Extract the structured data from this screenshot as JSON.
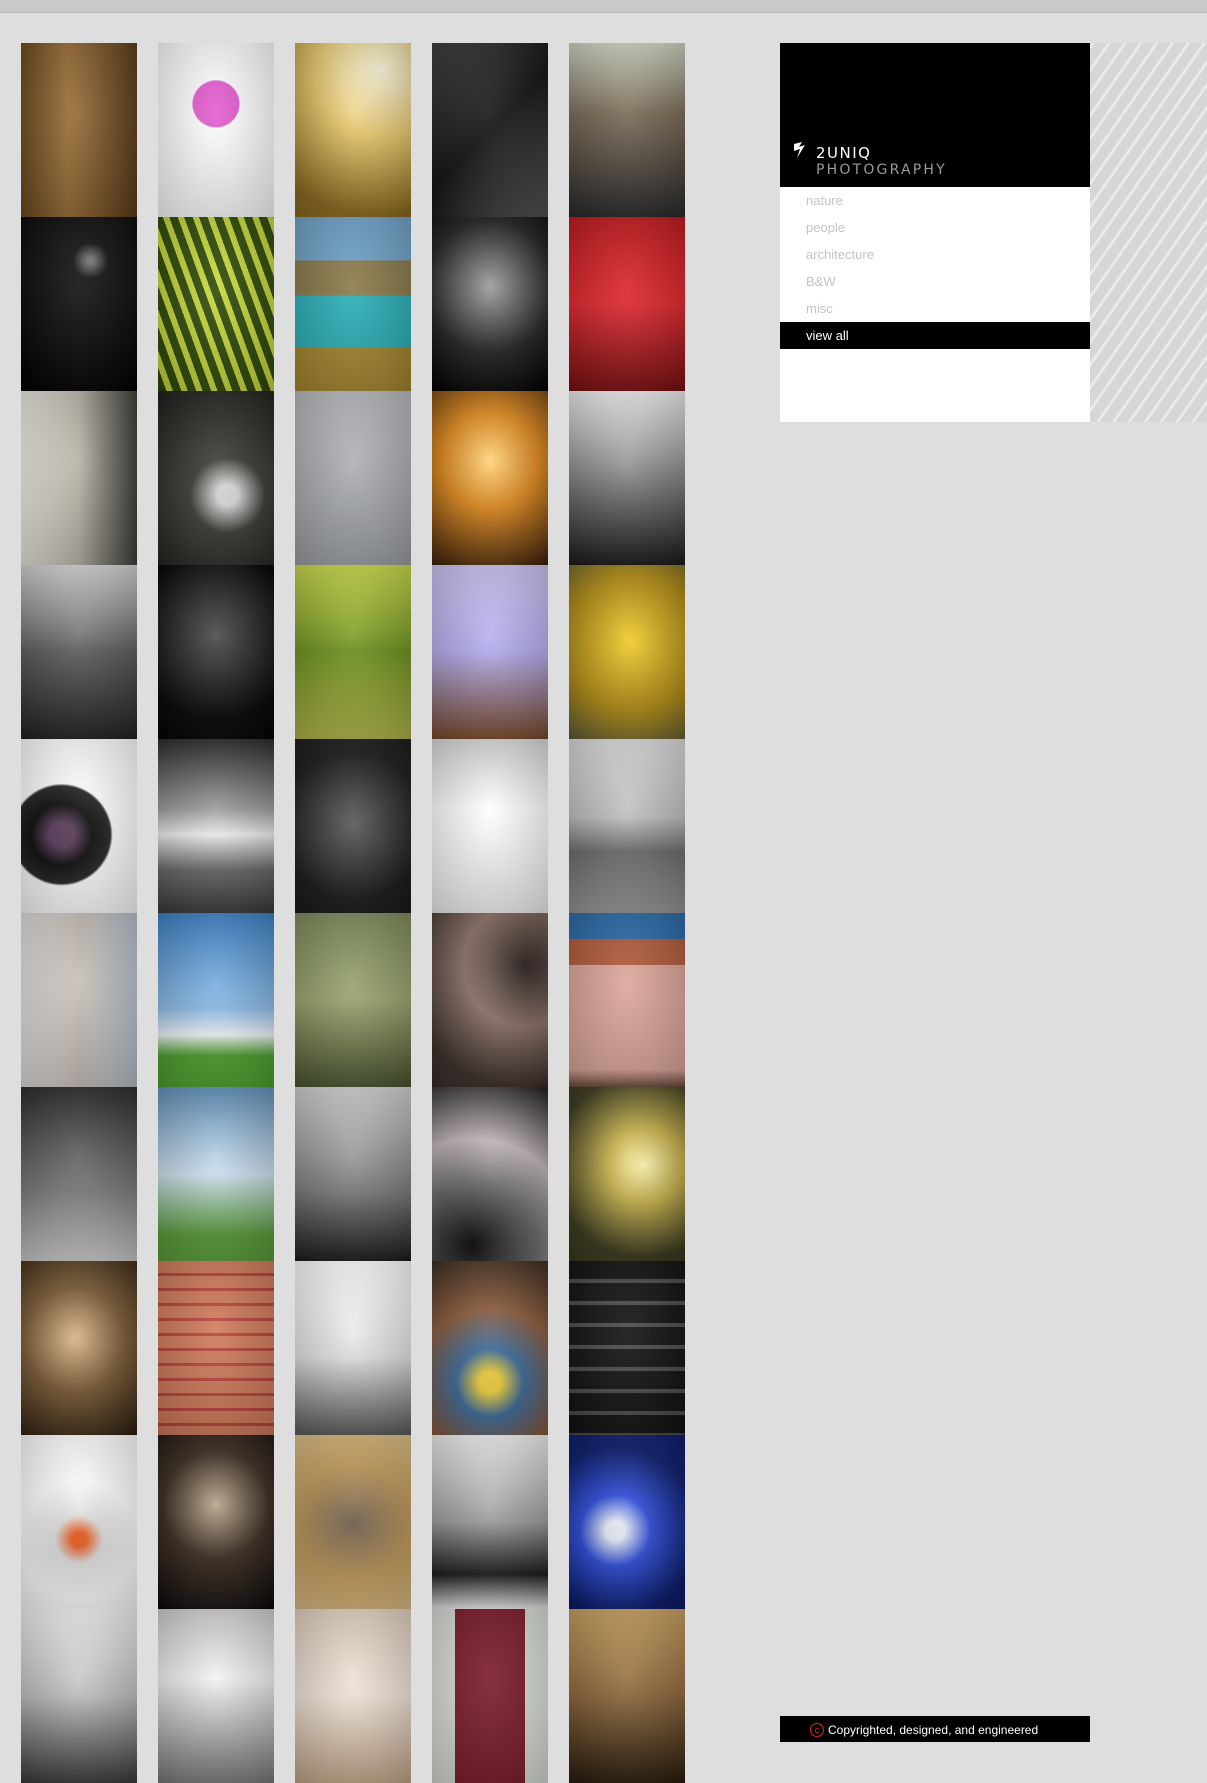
{
  "brand": {
    "line1": "2UNIQ",
    "line2": "PHOTOGRAPHY"
  },
  "nav": [
    {
      "label": "nature",
      "active": false
    },
    {
      "label": "people",
      "active": false
    },
    {
      "label": "architecture",
      "active": false
    },
    {
      "label": "B&W",
      "active": false
    },
    {
      "label": "misc",
      "active": false
    },
    {
      "label": "view all",
      "active": true
    }
  ],
  "footer": {
    "text": "Copyrighted, designed, and engineered"
  },
  "colors": {
    "background": "#dedede",
    "panel": "#ffffff",
    "logo_bg": "#000000",
    "nav_inactive": "#c3c3c3",
    "nav_active_bg": "#000000",
    "copyright_icon": "#e0242a"
  },
  "photos": [
    {
      "subject": "leaf-on-wood",
      "fill": "linear-gradient(90deg,#6b4a20,#9a6e35 40%,#7a5428 70%,#5a3c18)"
    },
    {
      "subject": "pink-orchid",
      "fill": "radial-gradient(circle at 50% 35%,#e35ccf 0 18%,#ffffff 19%)"
    },
    {
      "subject": "power-tower-sunset",
      "fill": "radial-gradient(circle at 75% 15%,#fffbe0,#e8c76a 40%,#8b6a1e 85%)"
    },
    {
      "subject": "horse-bw",
      "fill": "linear-gradient(135deg,#3c3c3c,#111 50%,#555)"
    },
    {
      "subject": "man-portrait",
      "fill": "linear-gradient(180deg,#cfd7c4,#7a6a55 40%,#2a2a2a)"
    },
    {
      "subject": "night-street",
      "fill": "radial-gradient(circle at 60% 25%,#777 0 2%,#111 12%,#000)"
    },
    {
      "subject": "green-leaf",
      "fill": "repeating-linear-gradient(70deg,#2f4a08 0 8px,#c9d83a 8px 14px)"
    },
    {
      "subject": "river-canyon",
      "fill": "linear-gradient(180deg,#6fa3c8 0 25%,#8a7a4a 25% 45%,#2ab0b8 45% 75%,#a6882f 75%)"
    },
    {
      "subject": "cap-portrait-bw",
      "fill": "radial-gradient(circle at 50% 40%,#9c9c9c,#222 55%,#000)"
    },
    {
      "subject": "red-box-latch",
      "fill": "linear-gradient(180deg,#c0181c,#e0262c 50%,#7a0f12)"
    },
    {
      "subject": "arm-window",
      "fill": "linear-gradient(90deg,#f2f0e8,#b7b2a6 50%,#3a3f37)"
    },
    {
      "subject": "sneakers-gravel",
      "fill": "radial-gradient(circle at 60% 60%,#ddd 0 8%,#3c3a35 30%,#1c1b18)"
    },
    {
      "subject": "branches-grey-sky",
      "fill": "linear-gradient(180deg,#b8babe,#9ea1a6)"
    },
    {
      "subject": "sunset-trees",
      "fill": "radial-gradient(circle at 50% 40%,#ffd27a,#e28a1c 40%,#3a1f0a)"
    },
    {
      "subject": "statue-clouds-bw",
      "fill": "linear-gradient(180deg,#efefef,#6d6d6d 60%,#1a1a1a)"
    },
    {
      "subject": "glasses-reflection-bw",
      "fill": "linear-gradient(180deg,#d5d5d5,#5a5a5a 50%,#222)"
    },
    {
      "subject": "smoke-bw",
      "fill": "radial-gradient(circle at 50% 40%,#4a4a4a,#050505 70%)"
    },
    {
      "subject": "bench-park",
      "fill": "linear-gradient(180deg,#c9d94a,#6c8f1c 50%,#b3b84a)"
    },
    {
      "subject": "gear-lavender",
      "fill": "linear-gradient(180deg,#cbc4f2,#b3acef 50%,#7a4a2a)"
    },
    {
      "subject": "yellow-tree",
      "fill": "radial-gradient(circle at 55% 45%,#f2cc2a,#b08a12 60%,#5a5a3a)"
    },
    {
      "subject": "camera-lens",
      "fill": "radial-gradient(circle at 35% 55%,#5a3a5a 0 10%,#0a0a0a 25%,#222 40%,#ffffff 42%)"
    },
    {
      "subject": "field-clouds-bw",
      "fill": "linear-gradient(180deg,#2a2a2a,#9a9a9a 40%,#f0f0f0 55%,#6a6a6a 75%,#3a3a3a)"
    },
    {
      "subject": "pattern-dark",
      "fill": "radial-gradient(circle at 50% 50%,#5a5a5a,#1a1a1a 70%)"
    },
    {
      "subject": "legs-white-floor",
      "fill": "linear-gradient(180deg,#d8d8d8,#ffffff 40%,#f2f2f2)"
    },
    {
      "subject": "golfer-bw",
      "fill": "linear-gradient(180deg,#dcdcdc,#bdbdbd 45%,#6a6a6a 65%,#9a9a9a)"
    },
    {
      "subject": "face-profile",
      "fill": "linear-gradient(90deg,#e4e2e0,#c6beb6 50%,#b9c1cd)"
    },
    {
      "subject": "blue-sky-green-field",
      "fill": "linear-gradient(180deg,#3b7fc4,#8cbde8 55%,#f4f8fc 70%,#4ea22e 82%)"
    },
    {
      "subject": "dandelions",
      "fill": "linear-gradient(180deg,#7d8a5a,#9aa56e 50%,#4b5530)"
    },
    {
      "subject": "flower-petals-mono",
      "fill": "radial-gradient(circle at 80% 30%,#2a1f1c,#8a7066 40%,#3a2d28 80%)"
    },
    {
      "subject": "brick-building",
      "fill": "linear-gradient(180deg,#2a6aa8 0 15%,#b25a3a 15% 30%,#dca69a 30% 90%,#6a4a3a)"
    },
    {
      "subject": "flags-bw",
      "fill": "linear-gradient(180deg,#2a2a2a,#7a7a7a 60%,#cfcfcf)"
    },
    {
      "subject": "clouds-hill",
      "fill": "linear-gradient(180deg,#5f8fb8,#cde1f0 50%,#5a9e3a 85%)"
    },
    {
      "subject": "statue-bw",
      "fill": "linear-gradient(180deg,#d2d2d2,#7a7a7a 60%,#1c1c1c)"
    },
    {
      "subject": "chrysanthemum-bw",
      "fill": "radial-gradient(circle at 35% 90%,#0a0a0a,#6a6a6a 35%,#c0b6ba 60%,#1a1a1a)"
    },
    {
      "subject": "crane-sunset",
      "fill": "radial-gradient(circle at 65% 45%,#fff6b0,#c8b24a 30%,#3a3a1e 75%)"
    },
    {
      "subject": "branches-sepia",
      "fill": "radial-gradient(circle at 45% 45%,#d8b78a,#7a5a34 45%,#2a1c0e)"
    },
    {
      "subject": "red-wood-stack",
      "fill": "repeating-linear-gradient(180deg,#d07a5a 0 12px,#b8413a 12px 15px)"
    },
    {
      "subject": "angel-statue",
      "fill": "linear-gradient(180deg,#ffffff,#e2e2e2 55%,#5a5a5a)"
    },
    {
      "subject": "ball-pool-kids",
      "fill": "radial-gradient(circle at 50% 70%,#f2d23a 0 8%,#3a6a9a 25%,#8a5a3a 55%,#3a2a1e)"
    },
    {
      "subject": "keyboard-bw",
      "fill": "repeating-linear-gradient(180deg,#111 0 18px,#4a4a4a 18px 22px)"
    },
    {
      "subject": "fishing-reel",
      "fill": "radial-gradient(circle at 50% 60%,#e85a1e 0 6%,#dedede 20%,#ffffff 50%)"
    },
    {
      "subject": "window-silhouette",
      "fill": "radial-gradient(circle at 50% 40%,#b7a58a,#3a2a1e 45%,#0a0a0a)"
    },
    {
      "subject": "dog-running",
      "fill": "radial-gradient(circle at 50% 50%,#6a5a4a,#c29a5a 55%,#e2c48a)"
    },
    {
      "subject": "ducks-decoys",
      "fill": "linear-gradient(180deg,#f0f0f0,#9a9a9a 50%,#1a1a1a 80%,#f0f0f0)"
    },
    {
      "subject": "blue-dome",
      "fill": "radial-gradient(circle at 40% 55%,#e8eef8 0 8%,#2a4ad8 30%,#0a1a6a 70%)"
    },
    {
      "subject": "kitchen-bw",
      "fill": "linear-gradient(180deg,#f2f2f2,#bdbdbd 50%,#3a3a3a)"
    },
    {
      "subject": "hospital-hall-bw",
      "fill": "linear-gradient(180deg,#cfcfcf,#f2f2f2 40%,#7a7a7a)"
    },
    {
      "subject": "white-flowers",
      "fill": "linear-gradient(180deg,#e2d2c0,#f0e4d8 50%,#c4a88a)"
    },
    {
      "subject": "red-door",
      "fill": "linear-gradient(90deg,#d8dcd6 0 20%,#7a1a28 20% 80%,#d8dcd6 80%)"
    },
    {
      "subject": "staircase",
      "fill": "linear-gradient(180deg,#c8a060,#8a6438 50%,#2a1c0c)"
    }
  ]
}
